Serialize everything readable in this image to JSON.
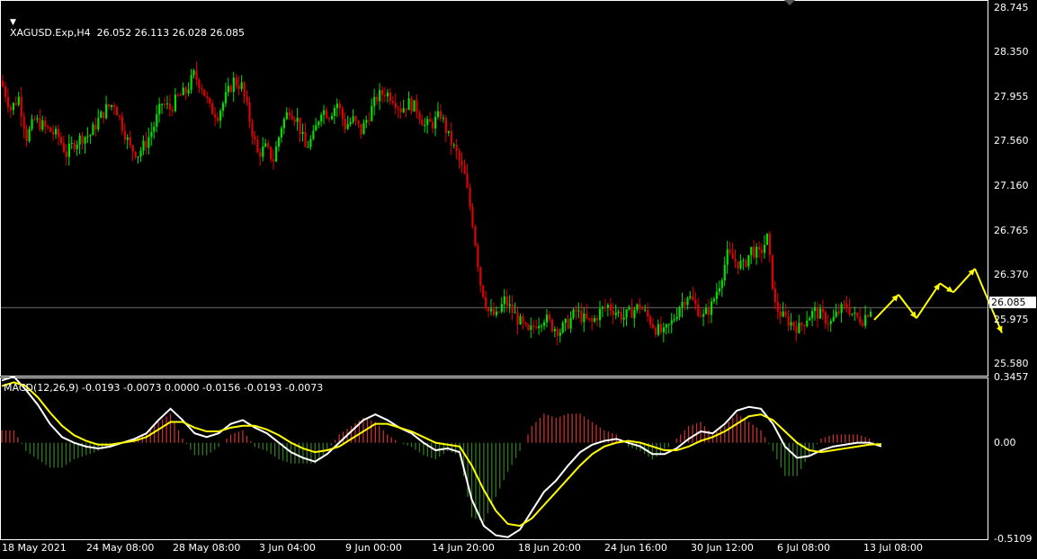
{
  "header": {
    "symbol_info": "XAGUSD.Exp,H4  26.052 26.113 26.028 26.085"
  },
  "macd_header": "MACD(12,26,9) -0.0193 -0.0073 0.0000 -0.0156 -0.0193 -0.0073",
  "price_axis": [
    "28.745",
    "28.350",
    "27.955",
    "27.560",
    "27.160",
    "26.765",
    "26.370",
    "25.975",
    "25.580"
  ],
  "current_price": "26.085",
  "macd_axis": [
    "0.3457",
    "0.00",
    "-0.5109"
  ],
  "time_axis": [
    "18 May 2021",
    "24 May 08:00",
    "28 May 08:00",
    "3 Jun 04:00",
    "9 Jun 00:00",
    "14 Jun 20:00",
    "18 Jun 20:00",
    "24 Jun 16:00",
    "30 Jun 12:00",
    "6 Jul 08:00",
    "13 Jul 08:00"
  ],
  "colors": {
    "background": "#000000",
    "bull": "#00e000",
    "bear": "#e00000",
    "macd_line": "#ffffff",
    "signal_line": "#ffff00",
    "hist_pos": "#c83030",
    "hist_neg": "#2f7a1f",
    "forecast": "#ffff00",
    "grid": "#ffffff"
  },
  "chart_data": [
    {
      "type": "candlestick",
      "symbol": "XAGUSD.Exp",
      "timeframe": "H4",
      "ylim": [
        25.48,
        28.8
      ],
      "x": [
        "18 May 2021",
        "24 May 08:00",
        "28 May 08:00",
        "3 Jun 04:00",
        "9 Jun 00:00",
        "14 Jun 20:00",
        "18 Jun 20:00",
        "24 Jun 16:00",
        "30 Jun 12:00",
        "6 Jul 08:00",
        "13 Jul 08:00"
      ],
      "current_price": 26.085,
      "close_series": [
        28.05,
        27.85,
        27.95,
        27.6,
        27.75,
        27.7,
        27.65,
        27.6,
        27.45,
        27.55,
        27.6,
        27.62,
        27.75,
        27.85,
        27.9,
        27.7,
        27.5,
        27.45,
        27.55,
        27.7,
        27.9,
        27.85,
        27.95,
        28.0,
        28.15,
        28.05,
        27.85,
        27.8,
        27.95,
        28.1,
        28.05,
        27.75,
        27.45,
        27.5,
        27.4,
        27.7,
        27.85,
        27.75,
        27.5,
        27.6,
        27.85,
        27.8,
        27.9,
        27.7,
        27.75,
        27.65,
        27.8,
        27.95,
        28.0,
        27.95,
        27.85,
        27.9,
        27.85,
        27.7,
        27.72,
        27.8,
        27.6,
        27.45,
        27.25,
        26.85,
        26.3,
        26.05,
        26.0,
        26.15,
        26.05,
        25.95,
        25.85,
        25.95,
        26.0,
        25.92,
        25.88,
        25.95,
        26.05,
        25.98,
        25.95,
        26.05,
        26.1,
        26.05,
        26.0,
        26.05,
        26.1,
        26.0,
        25.9,
        25.85,
        25.95,
        26.1,
        26.2,
        26.1,
        26.0,
        26.1,
        26.3,
        26.55,
        26.5,
        26.45,
        26.6,
        26.55,
        26.7,
        26.1,
        26.0,
        25.95,
        25.9,
        26.0,
        26.05,
        26.0,
        25.95,
        26.05,
        26.1,
        26.0,
        25.98,
        26.085
      ],
      "forecast_path": [
        25.975,
        26.2,
        25.99,
        26.3,
        26.22,
        26.43,
        25.86
      ],
      "price_axis_ticks": [
        28.745,
        28.35,
        27.955,
        27.56,
        27.16,
        26.765,
        26.37,
        25.975,
        25.58
      ]
    },
    {
      "type": "line",
      "name": "MACD(12,26,9)",
      "ylim": [
        -0.5109,
        0.3457
      ],
      "values_printed": [
        -0.0193,
        -0.0073,
        0.0,
        -0.0156,
        -0.0193,
        -0.0073
      ],
      "axis_ticks": [
        0.3457,
        0.0,
        -0.5109
      ],
      "macd": [
        0.33,
        0.35,
        0.28,
        0.2,
        0.1,
        0.03,
        0.0,
        -0.02,
        -0.03,
        -0.02,
        0.0,
        0.02,
        0.05,
        0.12,
        0.18,
        0.12,
        0.05,
        0.03,
        0.05,
        0.1,
        0.12,
        0.08,
        0.05,
        0.0,
        -0.05,
        -0.08,
        -0.1,
        -0.06,
        0.0,
        0.06,
        0.12,
        0.15,
        0.12,
        0.08,
        0.05,
        0.0,
        -0.04,
        -0.03,
        -0.05,
        -0.3,
        -0.44,
        -0.49,
        -0.5,
        -0.46,
        -0.36,
        -0.26,
        -0.2,
        -0.12,
        -0.05,
        -0.01,
        0.01,
        0.02,
        0.0,
        -0.02,
        -0.06,
        -0.06,
        -0.03,
        0.02,
        0.06,
        0.05,
        0.1,
        0.17,
        0.19,
        0.18,
        0.1,
        -0.02,
        -0.08,
        -0.07,
        -0.04,
        -0.02,
        -0.01,
        0.0,
        0.0,
        -0.0193
      ],
      "signal": [
        0.3,
        0.32,
        0.3,
        0.24,
        0.16,
        0.09,
        0.04,
        0.01,
        -0.01,
        -0.01,
        0.0,
        0.01,
        0.03,
        0.07,
        0.11,
        0.11,
        0.08,
        0.06,
        0.06,
        0.08,
        0.09,
        0.09,
        0.07,
        0.04,
        0.0,
        -0.03,
        -0.05,
        -0.04,
        -0.02,
        0.02,
        0.06,
        0.1,
        0.1,
        0.08,
        0.06,
        0.03,
        0.0,
        -0.01,
        -0.02,
        -0.12,
        -0.25,
        -0.36,
        -0.43,
        -0.44,
        -0.4,
        -0.33,
        -0.26,
        -0.19,
        -0.12,
        -0.06,
        -0.02,
        0.0,
        0.01,
        0.0,
        -0.02,
        -0.04,
        -0.04,
        -0.02,
        0.01,
        0.03,
        0.06,
        0.1,
        0.14,
        0.15,
        0.12,
        0.06,
        0.0,
        -0.04,
        -0.05,
        -0.04,
        -0.03,
        -0.02,
        -0.01,
        -0.0073
      ]
    }
  ]
}
